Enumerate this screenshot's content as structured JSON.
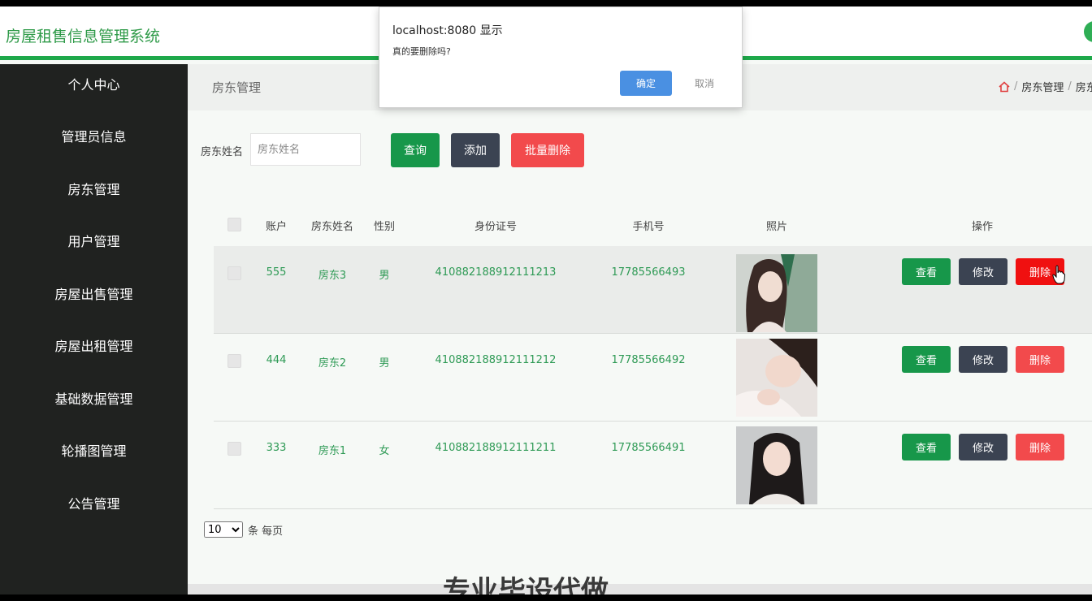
{
  "header": {
    "title": "房屋租售信息管理系统"
  },
  "sidebar": {
    "items": [
      {
        "label": "个人中心"
      },
      {
        "label": "管理员信息"
      },
      {
        "label": "房东管理"
      },
      {
        "label": "用户管理"
      },
      {
        "label": "房屋出售管理"
      },
      {
        "label": "房屋出租管理"
      },
      {
        "label": "基础数据管理"
      },
      {
        "label": "轮播图管理"
      },
      {
        "label": "公告管理"
      }
    ]
  },
  "page": {
    "title": "房东管理",
    "breadcrumb": [
      "房东管理",
      "房东"
    ]
  },
  "search": {
    "label": "房东姓名",
    "placeholder": "房东姓名",
    "query_label": "查询",
    "add_label": "添加",
    "batch_delete_label": "批量删除"
  },
  "table": {
    "columns": [
      "账户",
      "房东姓名",
      "性别",
      "身份证号",
      "手机号",
      "照片",
      "操作"
    ],
    "rows": [
      {
        "account": "555",
        "name": "房东3",
        "gender": "男",
        "id_card": "410882188912111213",
        "phone": "17785566493"
      },
      {
        "account": "444",
        "name": "房东2",
        "gender": "男",
        "id_card": "410882188912111212",
        "phone": "17785566492"
      },
      {
        "account": "333",
        "name": "房东1",
        "gender": "女",
        "id_card": "410882188912111211",
        "phone": "17785566491"
      }
    ],
    "actions": {
      "view": "查看",
      "edit": "修改",
      "delete": "删除"
    }
  },
  "pager": {
    "page_size": "10",
    "suffix": "条 每页"
  },
  "footer": {
    "text": "专业毕设代做"
  },
  "dialog": {
    "title": "localhost:8080 显示",
    "message": "真的要删除吗?",
    "ok_label": "确定",
    "cancel_label": "取消"
  },
  "colors": {
    "primary_green": "#17974a",
    "danger_red": "#f24a4c",
    "dark_slate": "#3b4352",
    "sidebar_bg": "#202220"
  }
}
